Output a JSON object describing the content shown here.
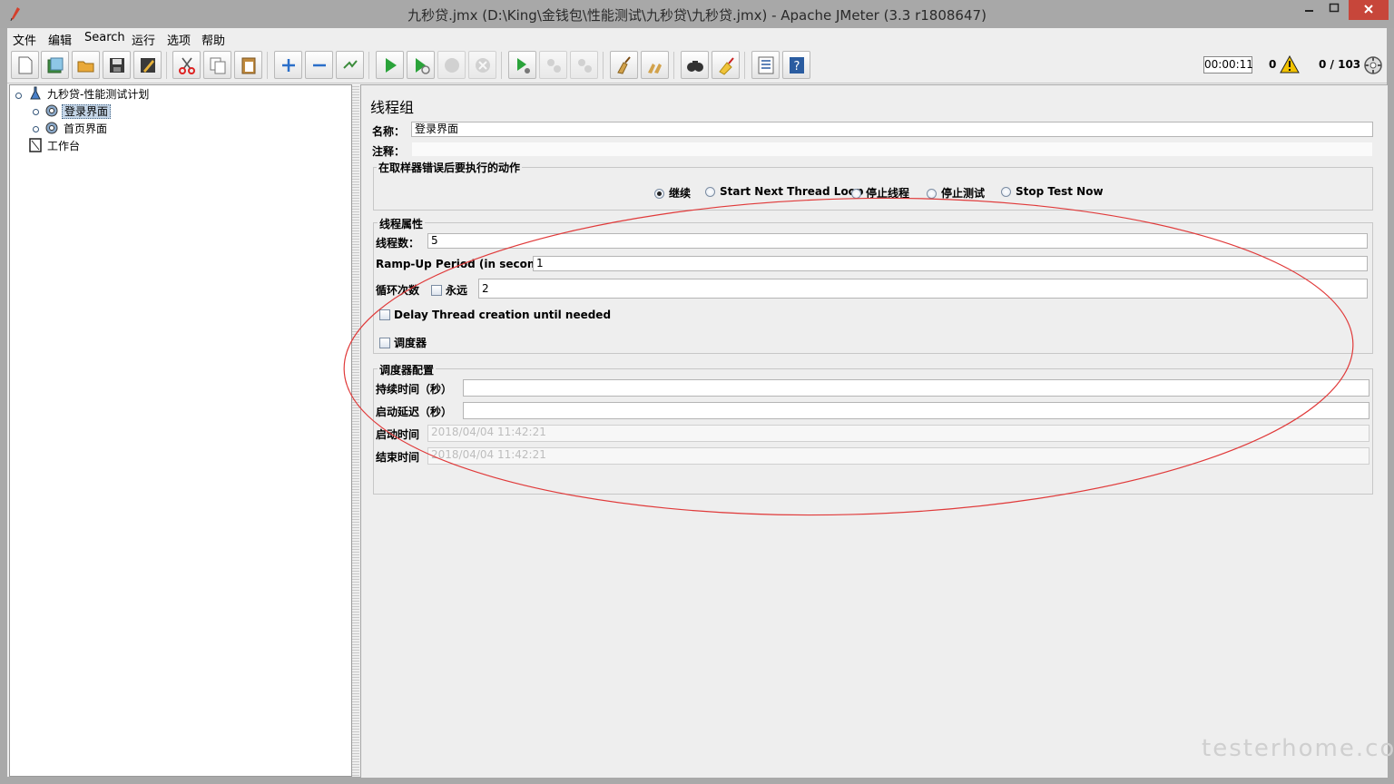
{
  "window": {
    "title": "九秒贷.jmx (D:\\King\\金钱包\\性能测试\\九秒贷\\九秒贷.jmx) - Apache JMeter (3.3 r1808647)",
    "min": "▭",
    "max": "□",
    "close": "✕"
  },
  "menu": [
    "文件",
    "编辑",
    "Search",
    "运行",
    "选项",
    "帮助"
  ],
  "toolbar": {
    "icons": [
      "new-icon",
      "templates-icon",
      "open-icon",
      "save-icon",
      "save-as-icon",
      "cut-icon",
      "copy-icon",
      "paste-icon",
      "expand-icon",
      "collapse-icon",
      "toggle-icon",
      "start-icon",
      "start-no-pause-icon",
      "stop-icon",
      "shutdown-icon",
      "remote-start-icon",
      "remote-stop-icon",
      "remote-shutdown-icon",
      "clear-icon",
      "clear-all-icon",
      "search-icon",
      "reset-search-icon",
      "function-helper-icon",
      "help-icon"
    ],
    "timer": "00:00:11",
    "error_count": "0",
    "threads": "0 / 103"
  },
  "tree": {
    "root": "九秒贷-性能测试计划",
    "items": [
      "登录界面",
      "首页界面"
    ],
    "workbench": "工作台",
    "selected_index": 0
  },
  "panel": {
    "title": "线程组",
    "name_label": "名称：",
    "name_value": "登录界面",
    "comment_label": "注释：",
    "comment_value": "",
    "on_error": {
      "title": "在取样器错误后要执行的动作",
      "options": [
        "继续",
        "Start Next Thread Loop",
        "停止线程",
        "停止测试",
        "Stop Test Now"
      ],
      "selected": 0
    },
    "thread_props": {
      "title": "线程属性",
      "threads_label": "线程数：",
      "threads_value": "5",
      "rampup_label": "Ramp-Up Period (in seconds):",
      "rampup_value": "1",
      "loop_label": "循环次数",
      "forever_label": "永远",
      "forever_checked": false,
      "loop_value": "2",
      "delay_label": "Delay Thread creation until needed",
      "delay_checked": false,
      "scheduler_label": "调度器",
      "scheduler_checked": false
    },
    "scheduler_config": {
      "title": "调度器配置",
      "duration_label": "持续时间（秒）",
      "duration_value": "",
      "delay_label": "启动延迟（秒）",
      "delay_value": "",
      "start_label": "启动时间",
      "start_value": "2018/04/04 11:42:21",
      "end_label": "结束时间",
      "end_value": "2018/04/04 11:42:21"
    }
  },
  "annotation_color": "#e03a3a",
  "watermark": "testerhome.com"
}
